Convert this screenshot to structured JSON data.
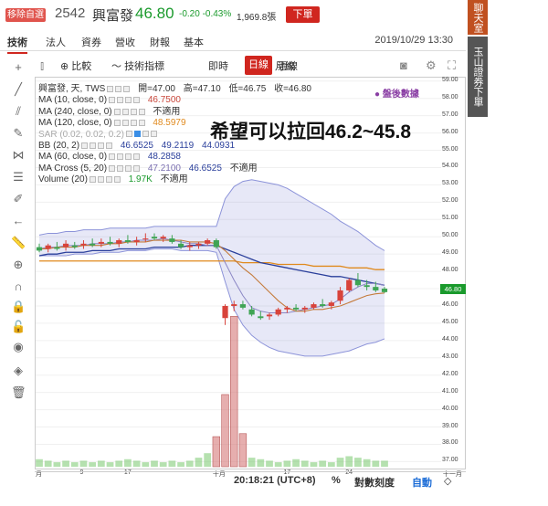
{
  "header": {
    "remove_label": "移除自選",
    "code": "2542",
    "name": "興富發",
    "price": "46.80",
    "change": "-0.20 -0.43%",
    "volume": "1,969.8張",
    "order_label": "下單"
  },
  "tabs": [
    {
      "label": "技術"
    },
    {
      "label": "法人"
    },
    {
      "label": "資券"
    },
    {
      "label": "營收"
    },
    {
      "label": "財報"
    },
    {
      "label": "基本"
    }
  ],
  "datetime": "2019/10/29 13:30",
  "toolbar": {
    "compare": "比較",
    "indicators": "技術指標",
    "intraday": "即時",
    "daily": "日線",
    "weekly": "週線",
    "monthly": "月線"
  },
  "legend": {
    "main": {
      "label": "興富發, 天, TWS",
      "open": "開=47.00",
      "high": "高=47.10",
      "low": "低=46.75",
      "close": "收=46.80"
    },
    "ma10": {
      "label": "MA (10, close, 0)",
      "value": "46.7500",
      "color": "#c9473b"
    },
    "ma240": {
      "label": "MA (240, close, 0)",
      "value": "不適用",
      "color": "#333333"
    },
    "ma120": {
      "label": "MA (120, close, 0)",
      "value": "48.5979",
      "color": "#e08a1e"
    },
    "sar": {
      "label": "SAR (0.02, 0.02, 0.2)"
    },
    "bb": {
      "label": "BB (20, 2)",
      "values": [
        "46.6525",
        "49.2119",
        "44.0931"
      ],
      "color": "#2a3f9b"
    },
    "ma60": {
      "label": "MA (60, close, 0)",
      "value": "48.2858",
      "color": "#2a3f9b"
    },
    "macross": {
      "label": "MA Cross (5, 20)",
      "values": [
        "47.2100",
        "46.6525",
        "不適用"
      ]
    },
    "volume": {
      "label": "Volume (20)",
      "values": [
        "1.97K",
        "不適用"
      ],
      "color": "#1a9a2c"
    }
  },
  "brand": "盤後數據",
  "annotation": "希望可以拉回46.2~45.8",
  "price_tag": "46.80",
  "y_ticks": [
    "59.00",
    "58.00",
    "57.00",
    "56.00",
    "55.00",
    "54.00",
    "53.00",
    "52.00",
    "51.00",
    "50.00",
    "49.00",
    "48.00",
    "47.00",
    "46.00",
    "45.00",
    "44.00",
    "43.00",
    "42.00",
    "41.00",
    "40.00",
    "39.00",
    "38.00",
    "37.00"
  ],
  "x_labels": [
    "月",
    "9",
    "17",
    "十月",
    "17",
    "24",
    "十一月"
  ],
  "status": {
    "time": "20:18:21 (UTC+8)",
    "percent": "%",
    "log": "對數刻度",
    "auto": "自動"
  },
  "right_panel": {
    "chat": "聊天室",
    "order": "玉山證券下單"
  },
  "chart_data": {
    "type": "candlestick",
    "ylim": [
      36.6,
      59.2
    ],
    "candles": [
      {
        "o": 49.4,
        "h": 49.6,
        "l": 49.1,
        "c": 49.2
      },
      {
        "o": 49.3,
        "h": 49.6,
        "l": 49.1,
        "c": 49.5
      },
      {
        "o": 49.4,
        "h": 49.7,
        "l": 49.2,
        "c": 49.3
      },
      {
        "o": 49.4,
        "h": 49.8,
        "l": 49.2,
        "c": 49.6
      },
      {
        "o": 49.5,
        "h": 49.7,
        "l": 49.3,
        "c": 49.4
      },
      {
        "o": 49.5,
        "h": 49.8,
        "l": 49.3,
        "c": 49.6
      },
      {
        "o": 49.6,
        "h": 49.9,
        "l": 49.4,
        "c": 49.5
      },
      {
        "o": 49.6,
        "h": 49.9,
        "l": 49.4,
        "c": 49.7
      },
      {
        "o": 49.7,
        "h": 50.0,
        "l": 49.5,
        "c": 49.6
      },
      {
        "o": 49.6,
        "h": 49.9,
        "l": 49.4,
        "c": 49.8
      },
      {
        "o": 49.8,
        "h": 50.1,
        "l": 49.6,
        "c": 49.7
      },
      {
        "o": 49.7,
        "h": 50.0,
        "l": 49.5,
        "c": 49.8
      },
      {
        "o": 49.9,
        "h": 50.2,
        "l": 49.7,
        "c": 49.9
      },
      {
        "o": 50.0,
        "h": 50.2,
        "l": 49.8,
        "c": 49.9
      },
      {
        "o": 49.9,
        "h": 50.1,
        "l": 49.7,
        "c": 50.0
      },
      {
        "o": 49.9,
        "h": 50.1,
        "l": 49.6,
        "c": 49.7
      },
      {
        "o": 49.6,
        "h": 49.8,
        "l": 49.3,
        "c": 49.4
      },
      {
        "o": 49.4,
        "h": 49.7,
        "l": 49.2,
        "c": 49.5
      },
      {
        "o": 49.5,
        "h": 49.7,
        "l": 49.3,
        "c": 49.6
      },
      {
        "o": 49.6,
        "h": 49.9,
        "l": 49.5,
        "c": 49.8
      },
      {
        "o": 49.8,
        "h": 49.9,
        "l": 49.3,
        "c": 49.4
      },
      {
        "o": 45.3,
        "h": 46.1,
        "l": 44.9,
        "c": 46.0
      },
      {
        "o": 46.0,
        "h": 46.3,
        "l": 45.7,
        "c": 46.1
      },
      {
        "o": 46.1,
        "h": 46.3,
        "l": 45.8,
        "c": 45.9
      },
      {
        "o": 45.8,
        "h": 46.0,
        "l": 45.4,
        "c": 45.5
      },
      {
        "o": 45.4,
        "h": 45.7,
        "l": 45.2,
        "c": 45.3
      },
      {
        "o": 45.4,
        "h": 45.6,
        "l": 45.2,
        "c": 45.5
      },
      {
        "o": 45.5,
        "h": 45.9,
        "l": 45.4,
        "c": 45.8
      },
      {
        "o": 45.8,
        "h": 46.0,
        "l": 45.6,
        "c": 45.9
      },
      {
        "o": 45.9,
        "h": 46.1,
        "l": 45.7,
        "c": 45.8
      },
      {
        "o": 45.8,
        "h": 46.0,
        "l": 45.6,
        "c": 45.9
      },
      {
        "o": 45.9,
        "h": 46.2,
        "l": 45.8,
        "c": 46.1
      },
      {
        "o": 46.1,
        "h": 46.4,
        "l": 45.9,
        "c": 46.0
      },
      {
        "o": 46.0,
        "h": 46.3,
        "l": 45.8,
        "c": 46.2
      },
      {
        "o": 46.3,
        "h": 47.1,
        "l": 46.1,
        "c": 46.9
      },
      {
        "o": 46.9,
        "h": 47.6,
        "l": 46.8,
        "c": 47.5
      },
      {
        "o": 47.5,
        "h": 47.9,
        "l": 47.1,
        "c": 47.2
      },
      {
        "o": 47.2,
        "h": 47.5,
        "l": 46.9,
        "c": 47.1
      },
      {
        "o": 47.1,
        "h": 47.4,
        "l": 46.8,
        "c": 46.9
      },
      {
        "o": 47.0,
        "h": 47.1,
        "l": 46.75,
        "c": 46.8
      }
    ],
    "volume_max_units": 100,
    "volumes": [
      5,
      4,
      3,
      4,
      3,
      4,
      3,
      4,
      3,
      4,
      5,
      4,
      3,
      4,
      3,
      4,
      3,
      4,
      6,
      9,
      20,
      48,
      100,
      22,
      6,
      5,
      4,
      3,
      4,
      5,
      4,
      3,
      4,
      3,
      6,
      7,
      6,
      5,
      4,
      4
    ],
    "bb_upper": [
      50.1,
      50.2,
      50.2,
      50.3,
      50.3,
      50.4,
      50.4,
      50.4,
      50.5,
      50.5,
      50.5,
      50.5,
      50.5,
      50.6,
      50.6,
      50.6,
      50.6,
      50.6,
      50.6,
      50.6,
      50.6,
      52.2,
      52.9,
      53.2,
      53.3,
      53.2,
      53.1,
      53.0,
      52.8,
      52.5,
      52.2,
      51.9,
      51.6,
      51.3,
      50.9,
      50.6,
      50.3,
      49.9,
      49.5,
      49.2
    ],
    "bb_lower": [
      48.9,
      48.9,
      48.9,
      48.9,
      49.0,
      49.0,
      49.0,
      49.1,
      49.1,
      49.1,
      49.2,
      49.2,
      49.2,
      49.3,
      49.3,
      49.3,
      49.2,
      49.2,
      49.2,
      49.2,
      49.1,
      47.4,
      45.8,
      44.9,
      44.3,
      43.9,
      43.6,
      43.4,
      43.3,
      43.2,
      43.1,
      43.1,
      43.1,
      43.2,
      43.3,
      43.4,
      43.6,
      43.8,
      43.9,
      44.1
    ],
    "ma60": [
      48.9,
      49.0,
      49.0,
      49.1,
      49.1,
      49.1,
      49.2,
      49.2,
      49.2,
      49.3,
      49.3,
      49.3,
      49.3,
      49.4,
      49.4,
      49.4,
      49.4,
      49.5,
      49.5,
      49.5,
      49.5,
      49.3,
      49.1,
      48.9,
      48.7,
      48.5,
      48.4,
      48.3,
      48.2,
      48.1,
      48.0,
      47.9,
      47.8,
      47.7,
      47.7,
      47.6,
      47.5,
      47.4,
      47.3,
      47.2
    ],
    "ma120": [
      48.6,
      48.6,
      48.6,
      48.6,
      48.6,
      48.6,
      48.6,
      48.6,
      48.6,
      48.6,
      48.6,
      48.6,
      48.6,
      48.6,
      48.6,
      48.6,
      48.6,
      48.6,
      48.6,
      48.6,
      48.6,
      48.6,
      48.6,
      48.5,
      48.5,
      48.5,
      48.5,
      48.4,
      48.4,
      48.4,
      48.4,
      48.3,
      48.3,
      48.3,
      48.3,
      48.2,
      48.2,
      48.2,
      48.1,
      48.1
    ],
    "ma10": [
      49.3,
      49.3,
      49.4,
      49.4,
      49.4,
      49.5,
      49.5,
      49.5,
      49.6,
      49.6,
      49.7,
      49.7,
      49.7,
      49.8,
      49.8,
      49.8,
      49.8,
      49.7,
      49.7,
      49.7,
      49.6,
      49.2,
      48.7,
      48.2,
      47.8,
      47.3,
      46.8,
      46.3,
      45.9,
      45.7,
      45.7,
      45.8,
      45.8,
      45.9,
      46.0,
      46.2,
      46.4,
      46.6,
      46.7,
      46.75
    ],
    "ma_cross_fast": [
      49.3,
      49.4,
      49.4,
      49.5,
      49.5,
      49.5,
      49.6,
      49.6,
      49.6,
      49.7,
      49.7,
      49.8,
      49.8,
      49.8,
      49.9,
      49.8,
      49.7,
      49.6,
      49.6,
      49.5,
      49.5,
      48.5,
      47.5,
      46.6,
      45.9,
      45.7,
      45.6,
      45.6,
      45.6,
      45.7,
      45.8,
      45.9,
      46.0,
      46.1,
      46.4,
      46.8,
      47.1,
      47.3,
      47.3,
      47.2
    ]
  }
}
